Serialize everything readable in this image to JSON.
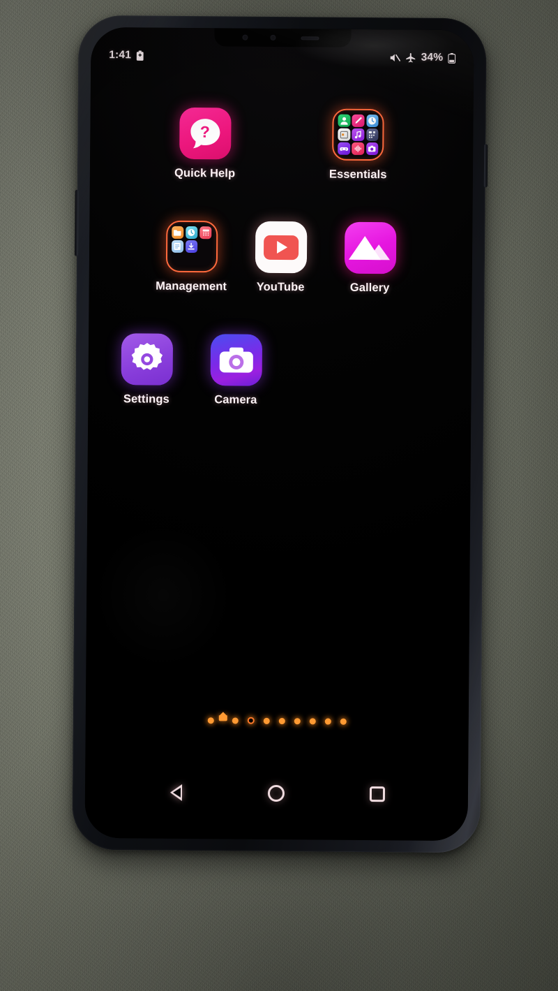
{
  "device": {
    "orientation": "portrait",
    "shell_color": "#14161b",
    "screen_bg": "#000000",
    "background_surface": "carpet"
  },
  "status_bar": {
    "time": "1:41",
    "left_icons": [
      "battery-saver-icon"
    ],
    "right_icons": [
      "mute-icon",
      "airplane-mode-icon"
    ],
    "battery_percent": "34%",
    "battery_icon": "battery-icon"
  },
  "home_screen": {
    "rows": [
      {
        "cells": [
          {
            "type": "empty"
          },
          {
            "type": "app",
            "name": "quick-help",
            "label": "Quick Help",
            "icon": "question-bubble-icon",
            "color": "#f0177f"
          },
          {
            "type": "empty"
          },
          {
            "type": "folder",
            "name": "essentials",
            "label": "Essentials",
            "border_color": "#ff6a3d",
            "mini_icons": [
              {
                "name": "contacts-icon",
                "glyph": "A",
                "color": "#1fb864"
              },
              {
                "name": "notes-pencil-icon",
                "glyph": "✎",
                "color": "#ef2d7a"
              },
              {
                "name": "clock-icon",
                "glyph": "◔",
                "color": "#4aa8f0"
              },
              {
                "name": "calendar-icon",
                "glyph": "▦",
                "color": "#f5f5f5"
              },
              {
                "name": "music-note-icon",
                "glyph": "♫",
                "color": "#a03ae8"
              },
              {
                "name": "calculator-icon",
                "glyph": "∷",
                "color": "#3d4a7a"
              },
              {
                "name": "game-controller-icon",
                "glyph": "⌘",
                "color": "#7a2ae0"
              },
              {
                "name": "audio-recorder-icon",
                "glyph": "‖",
                "color": "#ef3d6a"
              },
              {
                "name": "camera-icon",
                "glyph": "◯",
                "color": "#9b30e0"
              }
            ]
          },
          {
            "type": "empty"
          }
        ]
      },
      {
        "cells": [
          {
            "type": "folder",
            "name": "management",
            "label": "Management",
            "border_color": "#ff6a3d",
            "mini_icons": [
              {
                "name": "file-manager-icon",
                "glyph": "▭",
                "color": "#f2983d"
              },
              {
                "name": "smart-doctor-icon",
                "glyph": "⊕",
                "color": "#4ec8e0"
              },
              {
                "name": "calculator-icon",
                "glyph": "∷",
                "color": "#ef5a6a"
              },
              {
                "name": "notes-icon",
                "glyph": "▤",
                "color": "#9ecbef"
              },
              {
                "name": "downloads-icon",
                "glyph": "⬇",
                "color": "#5a5ae8"
              }
            ]
          },
          {
            "type": "app",
            "name": "youtube",
            "label": "YouTube",
            "icon": "youtube-play-icon",
            "color": "#f05451"
          },
          {
            "type": "app",
            "name": "gallery",
            "label": "Gallery",
            "icon": "mountain-photo-icon",
            "color": "#e617e0"
          }
        ]
      },
      {
        "cells": [
          {
            "type": "app",
            "name": "settings",
            "label": "Settings",
            "icon": "gear-icon",
            "color": "#8a3fdc"
          },
          {
            "type": "app",
            "name": "camera",
            "label": "Camera",
            "icon": "camera-icon",
            "color": "#7b2ae8"
          },
          {
            "type": "empty"
          }
        ]
      }
    ]
  },
  "page_indicator": {
    "total": 10,
    "current_index": 3,
    "home_index": 1,
    "dot_color": "#ff9a33",
    "current_color": "#ff7a2a"
  },
  "nav_bar": {
    "buttons": [
      {
        "name": "back-button",
        "icon": "back-triangle-icon"
      },
      {
        "name": "home-button",
        "icon": "home-circle-icon"
      },
      {
        "name": "recents-button",
        "icon": "recents-square-icon"
      }
    ]
  }
}
